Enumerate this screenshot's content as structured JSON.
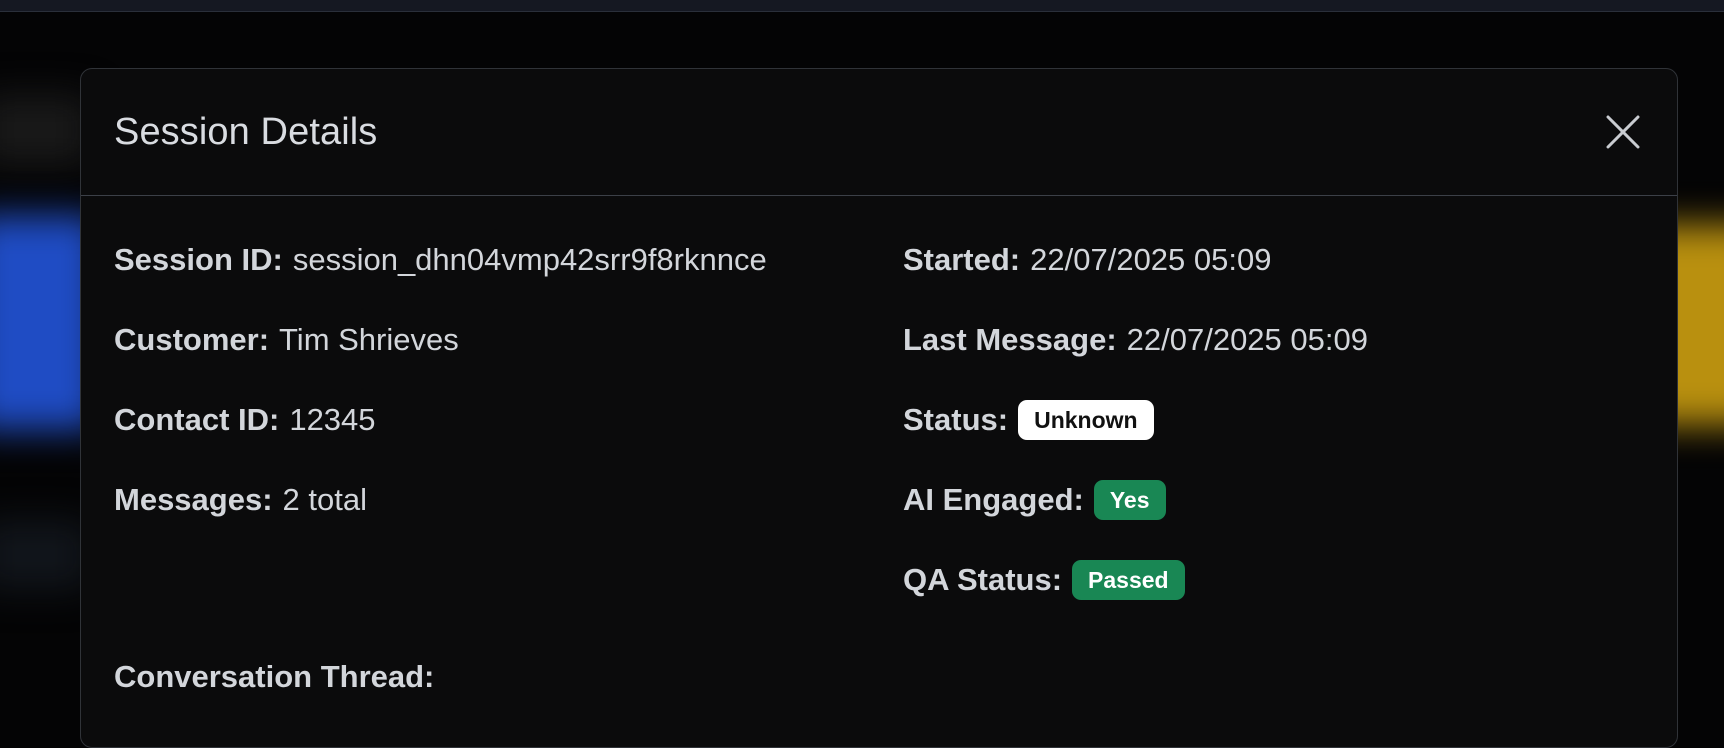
{
  "modal": {
    "title": "Session Details"
  },
  "details_left": [
    {
      "label": "Session ID:",
      "value": "session_dhn04vmp42srr9f8rknnce"
    },
    {
      "label": "Customer:",
      "value": "Tim Shrieves"
    },
    {
      "label": "Contact ID:",
      "value": "12345"
    },
    {
      "label": "Messages:",
      "value": "2 total"
    }
  ],
  "details_right": {
    "started": {
      "label": "Started:",
      "value": "22/07/2025 05:09"
    },
    "last_message": {
      "label": "Last Message:",
      "value": "22/07/2025 05:09"
    },
    "status": {
      "label": "Status:",
      "badge": "Unknown"
    },
    "ai_engaged": {
      "label": "AI Engaged:",
      "badge": "Yes"
    },
    "qa_status": {
      "label": "QA Status:",
      "badge": "Passed"
    }
  },
  "conversation": {
    "title": "Conversation Thread:"
  },
  "colors": {
    "badge_green": "#198754",
    "badge_light": "#ffffff",
    "modal_bg": "#0b0b0c"
  },
  "icons": {
    "close": "close-icon"
  }
}
